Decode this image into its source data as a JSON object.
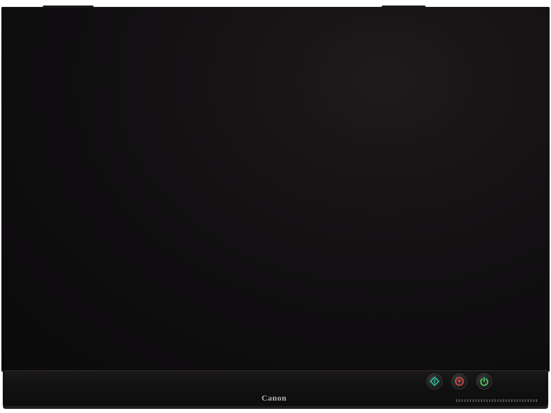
{
  "product": {
    "brand_logo_text": "Canon"
  },
  "buttons": [
    {
      "icon": "scan-start-icon",
      "color": "#2bbfa3"
    },
    {
      "icon": "stop-icon",
      "color": "#e24b4b"
    },
    {
      "icon": "power-icon",
      "color": "#4fd35b"
    }
  ]
}
